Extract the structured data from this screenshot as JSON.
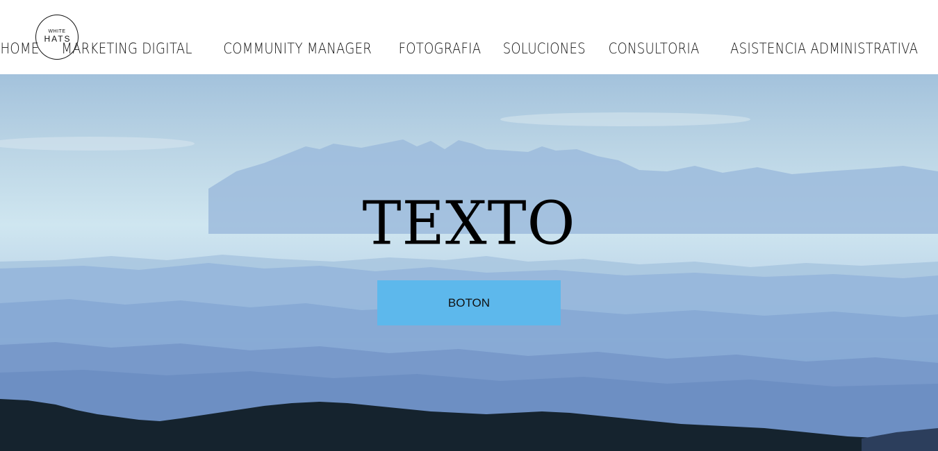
{
  "brand": {
    "logo_top": "WHITE",
    "logo_main": "HATS"
  },
  "nav": {
    "items": [
      {
        "label": "HOME"
      },
      {
        "label": "MARKETING DIGITAL"
      },
      {
        "label": "COMMUNITY MANAGER"
      },
      {
        "label": "FOTOGRAFIA"
      },
      {
        "label": "SOLUCIONES"
      },
      {
        "label": "CONSULTORIA"
      },
      {
        "label": "ASISTENCIA ADMINISTRATIVA"
      }
    ]
  },
  "hero": {
    "title": "TEXTO",
    "button_label": "BOTON",
    "button_color": "#5db8ec",
    "foreground_color": "#15232e"
  }
}
